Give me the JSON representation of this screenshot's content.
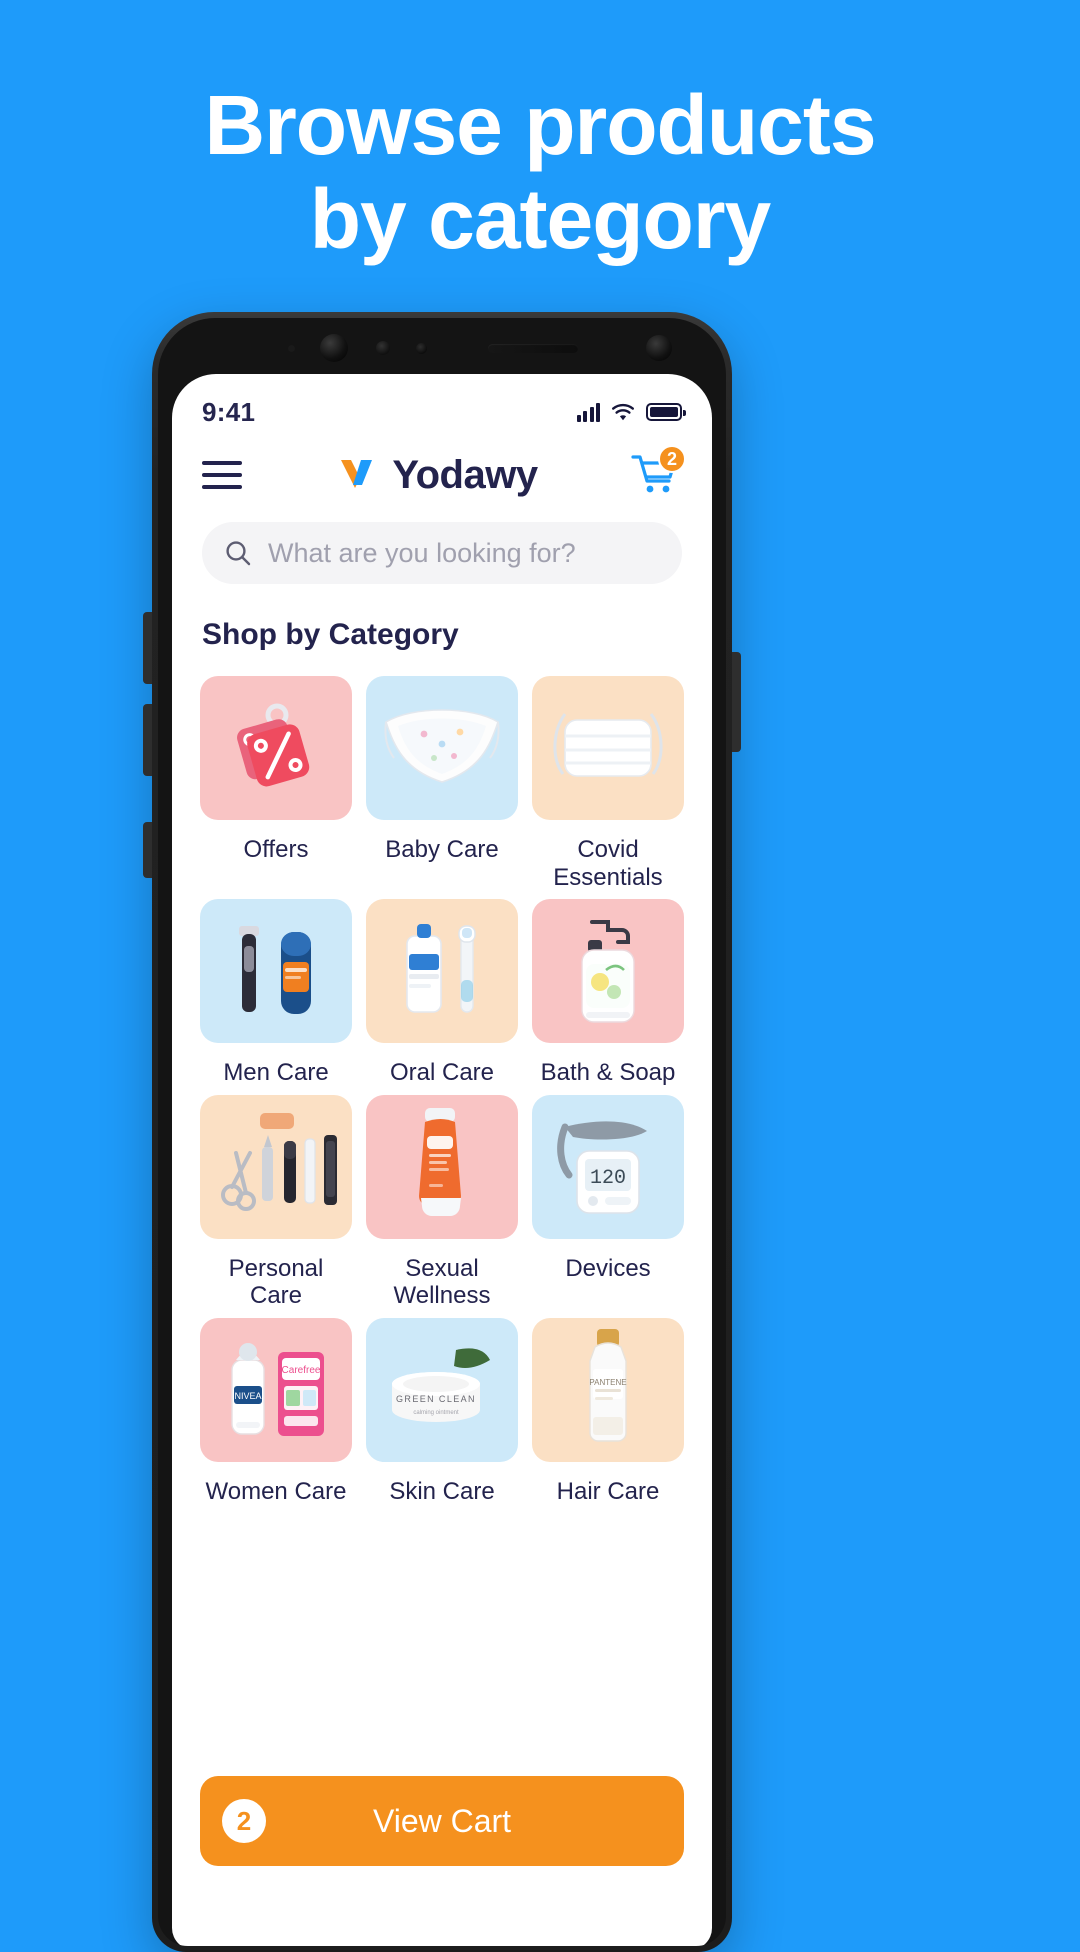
{
  "hero": {
    "line1": "Browse products",
    "line2": "by category",
    "bg_color": "#1E9BFA",
    "text_color": "#FFFFFF"
  },
  "phone": {
    "status": {
      "time": "9:41",
      "signal_icon": "cellular-signal-icon",
      "wifi_icon": "wifi-icon",
      "battery_icon": "battery-full-icon"
    },
    "appbar": {
      "menu_icon": "hamburger-menu-icon",
      "brand": "Yodawy",
      "brand_color": "#23234D",
      "logo_icon": "yodawy-logo-mark",
      "cart_icon": "shopping-cart-icon",
      "cart_count": "2",
      "cart_badge_color": "#F5911E"
    },
    "search": {
      "placeholder": "What are you looking for?",
      "icon": "search-icon"
    },
    "section": {
      "title": "Shop by Category"
    },
    "categories": [
      {
        "label": "Offers",
        "tile_color": "#F9C4C4",
        "art": "discount-tag"
      },
      {
        "label": "Baby Care",
        "tile_color": "#CDE9F9",
        "art": "diaper"
      },
      {
        "label": "Covid Essentials",
        "tile_color": "#FBE0C4",
        "art": "face-mask"
      },
      {
        "label": "Men Care",
        "tile_color": "#CDE9F9",
        "art": "razor-and-foam"
      },
      {
        "label": "Oral Care",
        "tile_color": "#FBE0C4",
        "art": "toothpaste-and-brush"
      },
      {
        "label": "Bath & Soap",
        "tile_color": "#F9C4C4",
        "art": "soap-dispenser"
      },
      {
        "label": "Personal Care",
        "tile_color": "#FBE0C4",
        "art": "grooming-kit"
      },
      {
        "label": "Sexual Wellness",
        "tile_color": "#F9C4C4",
        "art": "gel-tube"
      },
      {
        "label": "Devices",
        "tile_color": "#CDE9F9",
        "art": "blood-pressure-monitor"
      },
      {
        "label": "Women Care",
        "tile_color": "#F9C4C4",
        "art": "deodorant-and-pads"
      },
      {
        "label": "Skin Care",
        "tile_color": "#CDE9F9",
        "art": "cream-jar"
      },
      {
        "label": "Hair Care",
        "tile_color": "#FBE0C4",
        "art": "shampoo-bottle"
      }
    ],
    "view_cart": {
      "label": "View Cart",
      "count": "2",
      "color": "#F5911E"
    }
  }
}
